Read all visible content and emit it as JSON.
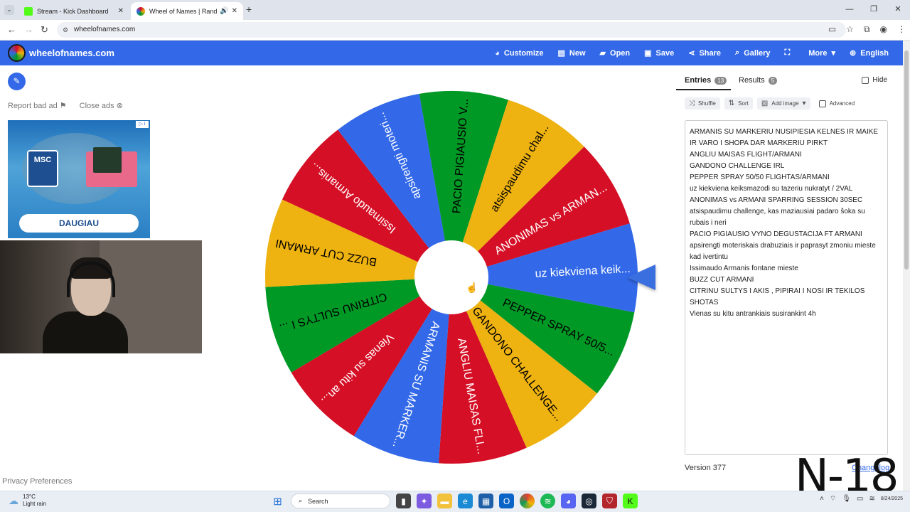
{
  "browser": {
    "tabs": [
      {
        "title": "Stream - Kick Dashboard",
        "favicon_color": "#53fc18"
      },
      {
        "title": "Wheel of Names | Random",
        "favicon_color": "#3369e8"
      }
    ],
    "url": "wheelofnames.com"
  },
  "app": {
    "brand": "wheelofnames.com",
    "menu": [
      {
        "label": "Customize",
        "icon": "palette-icon"
      },
      {
        "label": "New",
        "icon": "file-icon"
      },
      {
        "label": "Open",
        "icon": "folder-open-icon"
      },
      {
        "label": "Save",
        "icon": "save-icon"
      },
      {
        "label": "Share",
        "icon": "share-icon"
      },
      {
        "label": "Gallery",
        "icon": "search-icon"
      },
      {
        "label": "",
        "icon": "fullscreen-icon"
      },
      {
        "label": "More",
        "icon": "chevron-down-icon"
      },
      {
        "label": "English",
        "icon": "globe-icon"
      }
    ],
    "colors": {
      "header": "#3369e8",
      "red": "#d50f25",
      "yellow": "#eeb211",
      "green": "#009925",
      "blue": "#3369e8"
    }
  },
  "ads": {
    "report_label": "Report bad ad",
    "close_label": "Close ads",
    "ad_brand": "MSC",
    "ad_cta": "DAUGIAU"
  },
  "privacy_label": "Privacy Preferences",
  "wheel": {
    "segments": [
      {
        "label": "uz kiekviena keik...",
        "color": "#3369e8"
      },
      {
        "label": "PEPPER SPRAY 50/5...",
        "color": "#009925"
      },
      {
        "label": "GANDONO CHALLENGE...",
        "color": "#eeb211"
      },
      {
        "label": "ANGLIU MAISAS FLI...",
        "color": "#d50f25"
      },
      {
        "label": "ARMANIS SU MARKER...",
        "color": "#3369e8"
      },
      {
        "label": "Vienas su kitu an...",
        "color": "#d50f25"
      },
      {
        "label": "CITRINU SULTYS I ...",
        "color": "#009925"
      },
      {
        "label": "BUZZ CUT ARMANI",
        "color": "#eeb211"
      },
      {
        "label": "Issimaudo Armanis...",
        "color": "#d50f25"
      },
      {
        "label": "apsirengti moteri...",
        "color": "#3369e8"
      },
      {
        "label": "PACIO PIGIAUSIO V...",
        "color": "#009925"
      },
      {
        "label": "atsispaudimu chal...",
        "color": "#eeb211"
      },
      {
        "label": "ANONIMAS vs ARMAN...",
        "color": "#d50f25"
      }
    ]
  },
  "panel": {
    "tabs": [
      {
        "label": "Entries",
        "count": "13"
      },
      {
        "label": "Results",
        "count": "5"
      }
    ],
    "hide_label": "Hide",
    "toolbar": {
      "shuffle": "Shuffle",
      "sort": "Sort",
      "add_image": "Add image",
      "advanced": "Advanced"
    },
    "entries": [
      "ARMANIS SU MARKERIU NUSIPIESIA KELNES IR MAIKE IR VARO I SHOPA DAR MARKERIU PIRKT",
      "ANGLIU MAISAS FLIGHT/ARMANI",
      "GANDONO CHALLENGE IRL",
      "PEPPER SPRAY 50/50 FLIGHTAS/ARMANI",
      "uz kiekviena keiksmazodi su tazeriu nukratyt / 2VAL",
      "ANONIMAS vs ARMANI SPARRING SESSION 30SEC",
      "atsispaudimu challenge, kas maziausiai padaro šoka su rubais i neri",
      "PACIO PIGIAUSIO VYNO DEGUSTACIJA FT ARMANI",
      "apsirengti moteriskais drabuziais ir paprasyt zmoniu mieste kad ivertintu",
      "Issimaudo Armanis fontane mieste",
      "BUZZ CUT ARMANI",
      "CITRINU SULTYS I AKIS , PIPIRAI I NOSI IR TEKILOS SHOTAS",
      "Vienas su kitu antrankiais susirankint 4h"
    ],
    "version": "Version 377",
    "changelog": "Changelog"
  },
  "watermark": "N-18",
  "taskbar": {
    "temp": "13°C",
    "weather": "Light rain",
    "search": "Search",
    "date": "8/24/2025"
  }
}
